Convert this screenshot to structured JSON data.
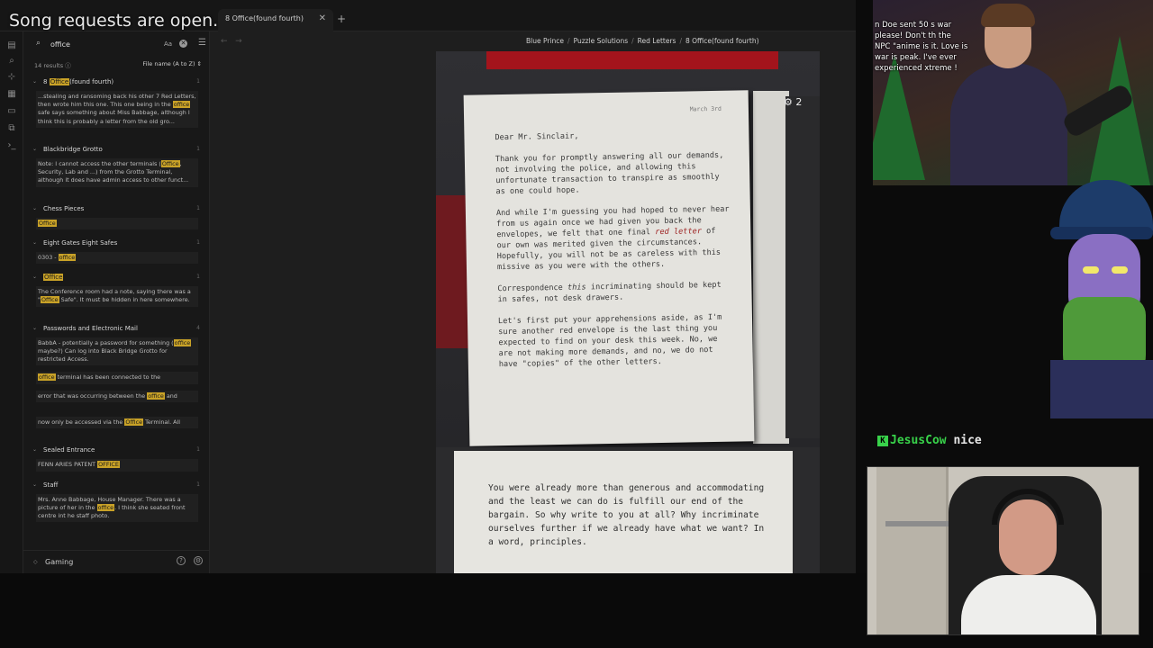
{
  "overlay": {
    "song_requests": "Song requests are open.",
    "top_chat": "n Doe sent 50 s war please! Don't th the NPC \"anime is it. Love is war is peak. I've ever experienced xtreme !",
    "chat": {
      "user": "JesusCow",
      "message": "nice",
      "badge": "K"
    }
  },
  "tabs": [
    {
      "label": "8 Office(found fourth)"
    }
  ],
  "new_tab": "+",
  "search": {
    "query": "office",
    "case_label": "Aa",
    "results_count": "14 results",
    "sort": "File name (A to Z)"
  },
  "results": [
    {
      "title_pre": "8 ",
      "title_hl": "Office",
      "title_post": "(found fourth)",
      "count": "1",
      "snippet_html": "...stealing and ransoming back his other 7 Red Letters, then wrote him this one. This one being in the <mark>office</mark> safe says something about Miss Babbage, although I think this is probably a letter from the old gro..."
    },
    {
      "title_pre": "Blackbridge Grotto",
      "title_hl": "",
      "title_post": "",
      "count": "1",
      "snippet_html": "Note: I cannot access the other terminals (<mark>Office</mark>, Security, Lab and ...) from the Grotto Terminal, although it does have admin access to other funct..."
    },
    {
      "title_pre": "Chess Pieces",
      "title_hl": "",
      "title_post": "",
      "count": "1",
      "snippet_html": "<mark>Office</mark>"
    },
    {
      "title_pre": "Eight Gates Eight Safes",
      "title_hl": "",
      "title_post": "",
      "count": "1",
      "snippet_html": "0303 - <mark>office</mark>"
    },
    {
      "title_pre": "",
      "title_hl": "Office",
      "title_post": "",
      "count": "1",
      "snippet_html": "The Conference room had a note, saying there was a \"<mark>Office</mark> Safe\". It must be hidden in here somewhere."
    },
    {
      "title_pre": "Passwords and Electronic Mail",
      "title_hl": "",
      "title_post": "",
      "count": "4",
      "snippets_html": [
        "BabbA - potentially a password for something (<mark>office</mark> maybe?) Can log into Black Bridge Grotto for restricted Access.",
        "<mark>office</mark> terminal has been connected to the",
        "error that was occurring between the <mark>office</mark> and",
        "now only be accessed via the <mark>Office</mark> Terminal. All"
      ]
    },
    {
      "title_pre": "Sealed Entrance",
      "title_hl": "",
      "title_post": "",
      "count": "1",
      "snippet_html": "FENN ARIES PATENT <mark>OFFICE</mark>"
    },
    {
      "title_pre": "Staff",
      "title_hl": "",
      "title_post": "",
      "count": "1",
      "snippet_html": "Mrs. Anne Babbage, House Manager. There was a picture of her in the <mark>office</mark>. I think she seated front centre int he staff photo."
    }
  ],
  "vault": "Gaming",
  "breadcrumbs": [
    "Blue Prince",
    "Puzzle Solutions",
    "Red Letters",
    "8 Office(found fourth)"
  ],
  "letter": {
    "date": "March 3rd",
    "salutation": "Dear Mr. Sinclair,",
    "p1": "Thank you for promptly answering all our demands, not involving the police, and allowing this unfortunate transaction to transpire as smoothly as one could hope.",
    "p2_pre": "And while I'm guessing you had hoped to never hear from us again once we had given you back the envelopes, we felt that one final ",
    "p2_red": "red letter",
    "p2_post": " of our own was merited given the circumstances. Hopefully, you will not be as careless with this missive as you were with the others.",
    "p3_pre": "Correspondence ",
    "p3_it": "this",
    "p3_post": " incriminating should be kept in safes, not desk drawers.",
    "p4": "Let's first put your apprehensions aside, as I'm sure another red envelope is the last thing you expected to find on your desk this week. No, we are not making more demands, and no, we do not have \"copies\" of the other letters.",
    "page_num": "2"
  },
  "letter2": {
    "text": "You were already more than generous and accommodating and the least we can do is fulfill our end of the bargain. So why write to you at all? Why incriminate ourselves further if we already have what we want? In a word, principles."
  },
  "icons": [
    "search-icon",
    "clear-icon",
    "sort-icon",
    "help-icon",
    "settings-icon",
    "close-icon"
  ],
  "colors": {
    "highlight": "#c9a227",
    "chat_green": "#38d24a",
    "red_letter": "#a3141c"
  }
}
